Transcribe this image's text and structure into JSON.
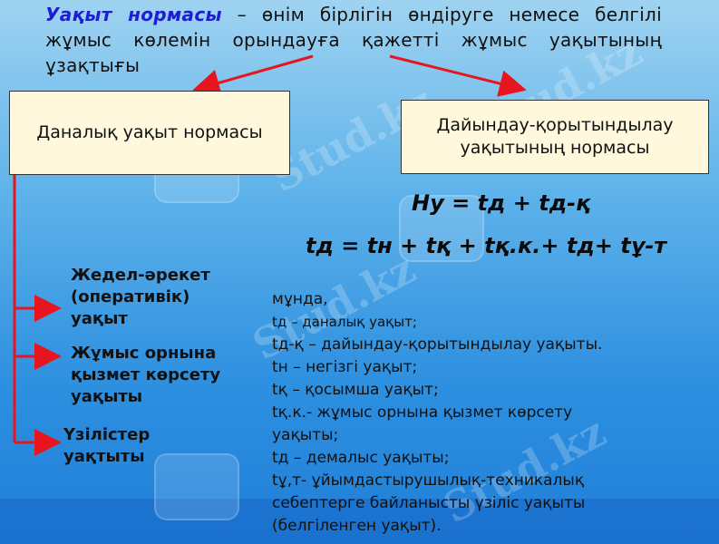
{
  "definition": {
    "term": "Уақыт нормасы",
    "text": " – өнім бірлігін өндіруге немесе белгілі жұмыс көлемін орындауға қажетті жұмыс уақытының ұзақтығы"
  },
  "boxes": {
    "left": "Даналық уақыт нормасы",
    "right_line1": "Дайындау-қорытындылау",
    "right_line2": "уақытының нормасы"
  },
  "formulas": {
    "f1": "Ну = tд + tд-қ",
    "f2": "tд = tн + tқ + tқ.к.+ tд+ tұ-т"
  },
  "categories": {
    "c1": [
      "Жедел-әрекет",
      "(оперативік)",
      "уақыт"
    ],
    "c2": [
      "Жұмыс орнына",
      "қызмет көрсету",
      "уақыты"
    ],
    "c3": [
      "Үзілістер",
      "уақтыты"
    ]
  },
  "legend": {
    "l1": "мұнда,",
    "l2": "tд – даналық уақыт;",
    "l3": "tд-қ – дайындау-қорытындылау уақыты.",
    "l4": "tн – негізгі уақыт;",
    "l5": "tқ – қосымша уақыт;",
    "l6": "tқ.к.- жұмыс орнына қызмет көрсету",
    "l7": "уақыты;",
    "l8": "tд – демалыс уақыты;",
    "l9": "tұ,т- ұйымдастырушылық-техникалық",
    "l10": "себептерге байланысты үзіліс уақыты",
    "l11": "(белгіленген уақыт)."
  },
  "colors": {
    "arrow": "#e8141e",
    "term": "#1e1ed0",
    "box_fill": "#fff8dc"
  }
}
